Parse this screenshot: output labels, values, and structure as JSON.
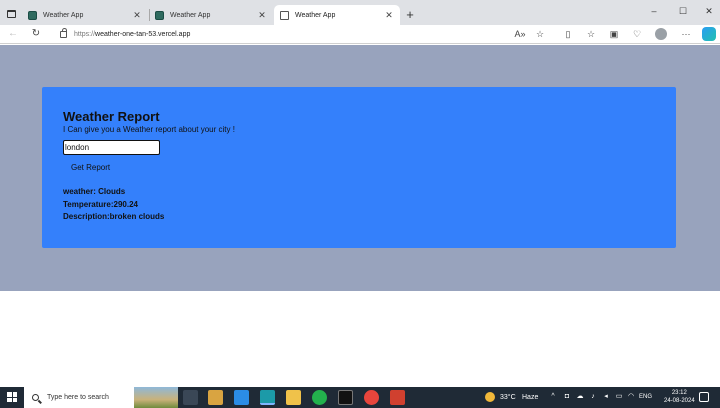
{
  "browser": {
    "tabs": [
      {
        "label": "Weather App",
        "active": false
      },
      {
        "label": "Weather App",
        "active": false
      },
      {
        "label": "Weather App",
        "active": true
      }
    ],
    "new_tab_label": "+",
    "url_scheme": "https://",
    "url_host": "weather-one-tan-53.vercel.app",
    "window_controls": {
      "minimize": "–",
      "maximize": "☐",
      "close": "✕"
    }
  },
  "page": {
    "title": "Weather Report",
    "subtitle": "I Can give you a Weather report about your city !",
    "city_input_value": "london",
    "button_label": "Get Report",
    "result": {
      "weather": "weather: Clouds",
      "temperature": "Temperature:290.24",
      "description": "Description:broken clouds"
    },
    "colors": {
      "background": "#98a3bd",
      "card": "#3480fb"
    }
  },
  "taskbar": {
    "search_placeholder": "Type here to search",
    "weather_temp": "33°C",
    "weather_condition": "Haze",
    "language": "ENG",
    "time": "23:12",
    "date": "24-08-2024"
  }
}
